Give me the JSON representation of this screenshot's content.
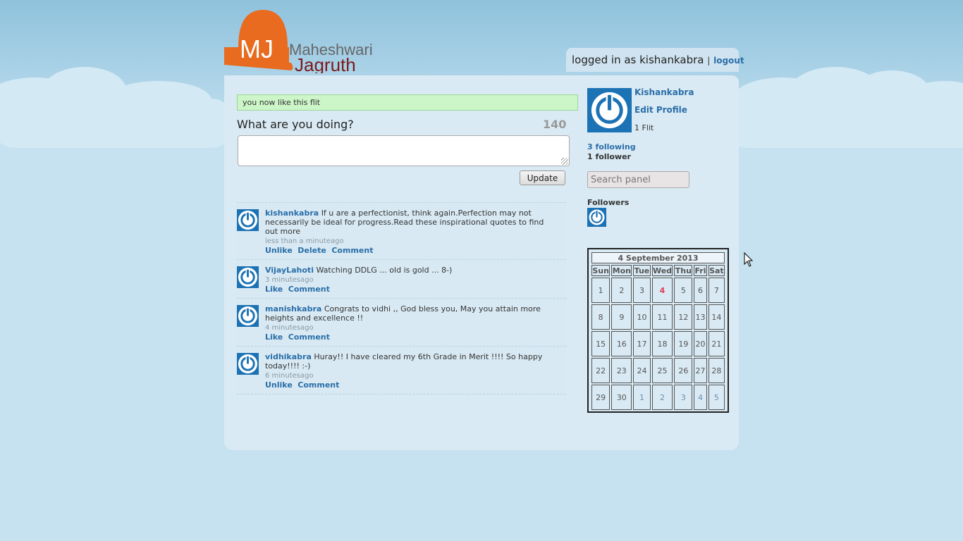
{
  "brand": {
    "mark": "MJ",
    "name_line1": "Maheshwari",
    "name_line2": "Jagruth",
    "colors": {
      "orange": "#e86b1f",
      "maroon": "#7a1b1b",
      "gray": "#666666"
    }
  },
  "login": {
    "text": "logged in as kishankabra",
    "separator": "|",
    "logout_label": "logout"
  },
  "notice": "you now like this flit",
  "composer": {
    "question": "What are you doing?",
    "counter": "140",
    "value": "",
    "update_label": "Update"
  },
  "feed": [
    {
      "user": "kishankabra",
      "text": "If u are a perfectionist, think again.Perfection may not necessarily be ideal for progress.Read these inspirational quotes to find out more",
      "time": "less than a minuteago",
      "actions": [
        "Unlike",
        "Delete",
        "Comment"
      ]
    },
    {
      "user": "VijayLahoti",
      "text": "Watching DDLG ... old is gold ... 8-)",
      "time": "3 minutesago",
      "actions": [
        "Like",
        "Comment"
      ]
    },
    {
      "user": "manishkabra",
      "text": "Congrats to vidhi ,, God bless you, May you attain more heights and excellence !!",
      "time": "4 minutesago",
      "actions": [
        "Like",
        "Comment"
      ]
    },
    {
      "user": "vidhikabra",
      "text": "Huray!! I have cleared my 6th Grade in Merit !!!! So happy today!!!! :-)",
      "time": "6 minutesago",
      "actions": [
        "Unlike",
        "Comment"
      ]
    }
  ],
  "profile": {
    "name": "Kishankabra",
    "edit_label": "Edit Profile",
    "flits": "1 Flit",
    "following": "3 following",
    "followers_count": "1 follower",
    "search_placeholder": "Search panel",
    "followers_title": "Followers"
  },
  "calendar": {
    "title": "4 September 2013",
    "days": [
      "Sun",
      "Mon",
      "Tue",
      "Wed",
      "Thu",
      "Fri",
      "Sat"
    ],
    "today": "4",
    "weeks": [
      [
        "1",
        "2",
        "3",
        "4",
        "5",
        "6",
        "7"
      ],
      [
        "8",
        "9",
        "10",
        "11",
        "12",
        "13",
        "14"
      ],
      [
        "15",
        "16",
        "17",
        "18",
        "19",
        "20",
        "21"
      ],
      [
        "22",
        "23",
        "24",
        "25",
        "26",
        "27",
        "28"
      ],
      [
        "29",
        "30",
        "1",
        "2",
        "3",
        "4",
        "5"
      ]
    ],
    "other_month_last_row_from": 2
  },
  "icons": {
    "avatar": "power-icon",
    "cursor": "mouse-pointer-icon"
  }
}
